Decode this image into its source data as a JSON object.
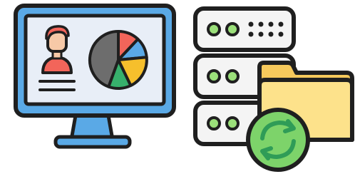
{
  "illustration": {
    "monitor_icon": "monitor-dashboard-icon",
    "server_icon": "server-rack-icon",
    "folder_icon": "folder-icon",
    "sync_icon": "sync-arrows-icon"
  },
  "colors": {
    "outline": "#1f1f1f",
    "monitor_frame": "#5aa9e6",
    "screen_bg": "#e8eef7",
    "person_shirt": "#f2655a",
    "person_face": "#f7c9a7",
    "pie_gray": "#6d6d6d",
    "pie_red": "#f2655a",
    "pie_blue": "#5aa9e6",
    "pie_yellow": "#f6bf2c",
    "pie_green": "#37b06c",
    "server_bg": "#f4f4f4",
    "server_led": "#9be07a",
    "folder_back": "#f6c95c",
    "folder_front": "#fde28b",
    "sync_green": "#7dd36a",
    "sync_dark": "#2f9c57"
  }
}
